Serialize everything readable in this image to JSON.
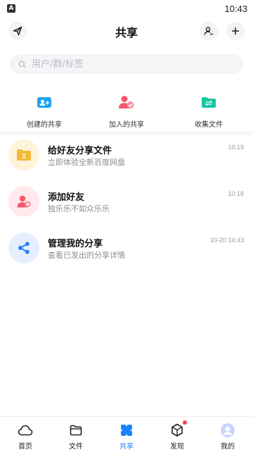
{
  "status_bar": {
    "indicator": "A",
    "time": "10:43"
  },
  "header": {
    "title": "共享"
  },
  "search": {
    "placeholder": "用户/群/标签"
  },
  "shortcuts": [
    {
      "label": "创建的共享",
      "icon": "create-share-icon",
      "color": "#1fa2f5"
    },
    {
      "label": "加入的共享",
      "icon": "joined-share-icon",
      "color": "#f5566f"
    },
    {
      "label": "收集文件",
      "icon": "collect-files-icon",
      "color": "#16c6a3"
    }
  ],
  "list": [
    {
      "name": "给好友分享文件",
      "subtitle": "立即体验全新百度网盘",
      "time": "10:19",
      "icon": "folder-share-icon",
      "color": "#fff3da"
    },
    {
      "name": "添加好友",
      "subtitle": "独乐乐不如众乐乐",
      "time": "10:18",
      "icon": "add-friend-icon",
      "color": "#ffe9ec"
    },
    {
      "name": "管理我的分享",
      "subtitle": "查看已发出的分享详情",
      "time": "10-20 14:43",
      "icon": "share-manage-icon",
      "color": "#e6efff"
    }
  ],
  "bottom_nav": [
    {
      "label": "首页",
      "icon": "cloud-home-icon"
    },
    {
      "label": "文件",
      "icon": "folder-icon"
    },
    {
      "label": "共享",
      "icon": "share-icon",
      "active": true
    },
    {
      "label": "发现",
      "icon": "cube-icon"
    },
    {
      "label": "我的",
      "icon": "profile-icon"
    }
  ],
  "colors": {
    "accent": "#1a82ff",
    "badge": "#ff3b58"
  }
}
